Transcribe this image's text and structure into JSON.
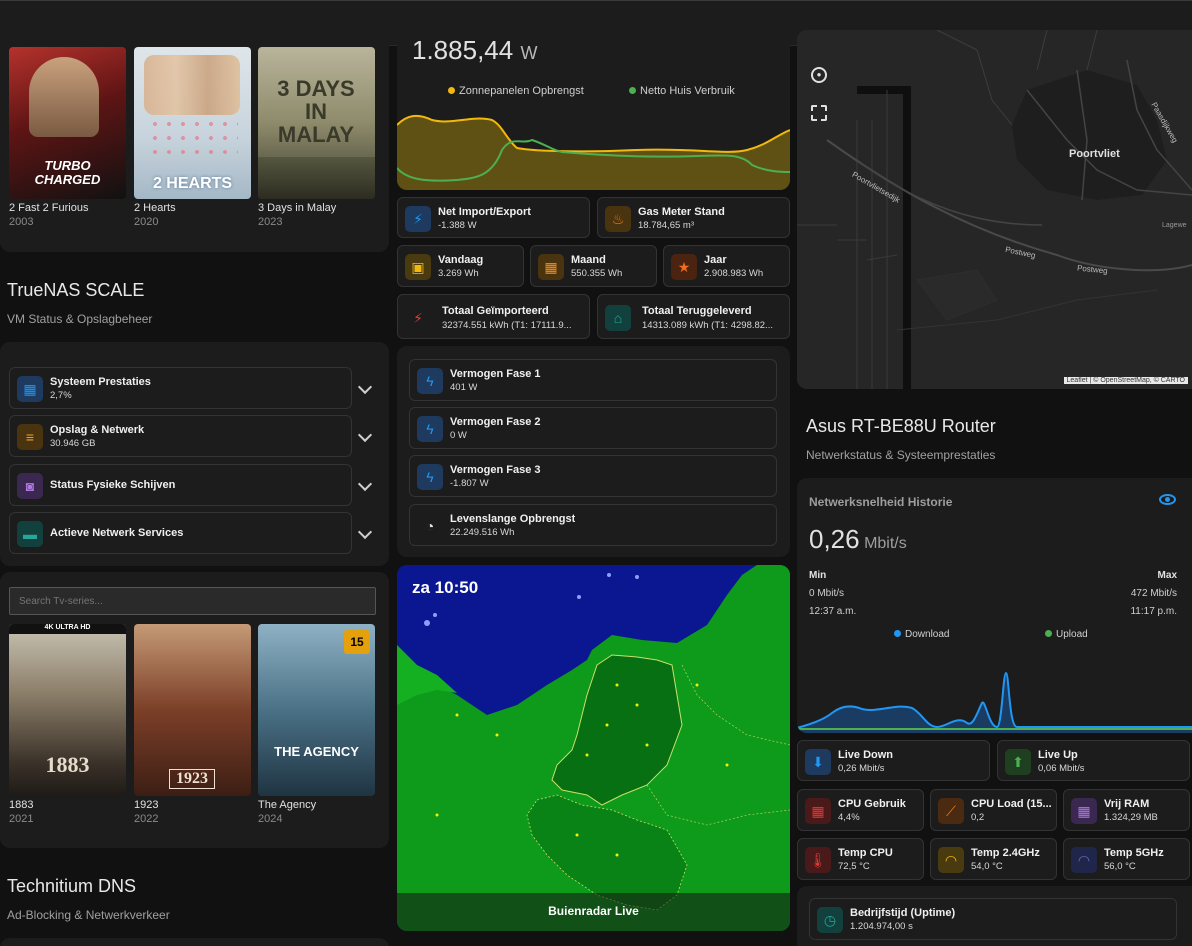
{
  "movies": [
    {
      "title": "2 Fast 2 Furious",
      "year": "2003",
      "art": "TURBO CHARGED"
    },
    {
      "title": "2 Hearts",
      "year": "2020",
      "art": "2 HEARTS"
    },
    {
      "title": "3 Days in Malay",
      "year": "2023",
      "art": "3 DAYS IN MALAY"
    }
  ],
  "truenas": {
    "title": "TrueNAS SCALE",
    "subtitle": "VM Status & Opslagbeheer",
    "rows": [
      {
        "label": "Systeem Prestaties",
        "value": "2,7%"
      },
      {
        "label": "Opslag & Netwerk",
        "value": "30.946 GB"
      },
      {
        "label": "Status Fysieke Schijven",
        "value": ""
      },
      {
        "label": "Actieve Netwerk Services",
        "value": ""
      }
    ]
  },
  "tvseries": {
    "search_placeholder": "Search Tv-series...",
    "items": [
      {
        "title": "1883",
        "year": "2021",
        "art": "1883"
      },
      {
        "title": "1923",
        "year": "2022",
        "art": "1923"
      },
      {
        "title": "The Agency",
        "year": "2024",
        "art": "THE AGENCY",
        "badge": "15"
      }
    ]
  },
  "technitium": {
    "title": "Technitium DNS",
    "subtitle": "Ad-Blocking & Netwerkverkeer"
  },
  "energy": {
    "current_value": "1.885,44",
    "current_unit": "W",
    "legend": [
      "Zonnepanelen Opbrengst",
      "Netto Huis Verbruik"
    ],
    "colors": {
      "solar": "#f2b90c",
      "net": "#4caf50"
    },
    "tiles": [
      {
        "label": "Net Import/Export",
        "value": "-1.388 W"
      },
      {
        "label": "Gas Meter Stand",
        "value": "18.784,65 m³"
      },
      {
        "label": "Vandaag",
        "value": "3.269 Wh"
      },
      {
        "label": "Maand",
        "value": "550.355 Wh"
      },
      {
        "label": "Jaar",
        "value": "2.908.983 Wh"
      },
      {
        "label": "Totaal Geïmporteerd",
        "value": "32374.551 kWh (T1: 17111.9..."
      },
      {
        "label": "Totaal Teruggeleverd",
        "value": "14313.089 kWh (T1: 4298.82..."
      }
    ]
  },
  "phases": [
    {
      "label": "Vermogen Fase 1",
      "value": "401 W"
    },
    {
      "label": "Vermogen Fase 2",
      "value": "0 W"
    },
    {
      "label": "Vermogen Fase 3",
      "value": "-1.807 W"
    },
    {
      "label": "Levenslange Opbrengst",
      "value": "22.249.516 Wh"
    }
  ],
  "radar": {
    "time": "za 10:50",
    "caption": "Buienradar Live"
  },
  "map": {
    "labels": [
      "Poortvliet",
      "Poortvlietsedijk",
      "Postweg",
      "Postweg",
      "Paasdijkweg",
      "Lagewe"
    ],
    "attribution": "Leaflet | © OpenStreetMap, © CARTO"
  },
  "router": {
    "title": "Asus RT-BE88U Router",
    "subtitle": "Netwerkstatus & Systeemprestaties",
    "history_title": "Netwerksnelheid Historie",
    "speed_value": "0,26",
    "speed_unit": "Mbit/s",
    "min_label": "Min",
    "max_label": "Max",
    "min_value": "0 Mbit/s",
    "max_value": "472 Mbit/s",
    "min_time": "12:37 a.m.",
    "max_time": "11:17 p.m.",
    "legend": [
      "Download",
      "Upload"
    ],
    "colors": {
      "download": "#2196f3",
      "upload": "#4caf50"
    },
    "tiles": [
      {
        "label": "Live Down",
        "value": "0,26 Mbit/s"
      },
      {
        "label": "Live Up",
        "value": "0,06 Mbit/s"
      },
      {
        "label": "CPU Gebruik",
        "value": "4,4%"
      },
      {
        "label": "CPU Load (15...",
        "value": "0,2"
      },
      {
        "label": "Vrij RAM",
        "value": "1.324,29 MB"
      },
      {
        "label": "Temp CPU",
        "value": "72,5 °C"
      },
      {
        "label": "Temp 2.4GHz",
        "value": "54,0 °C"
      },
      {
        "label": "Temp 5GHz",
        "value": "56,0 °C"
      },
      {
        "label": "Bedrijfstijd (Uptime)",
        "value": "1.204.974,00 s"
      }
    ]
  }
}
